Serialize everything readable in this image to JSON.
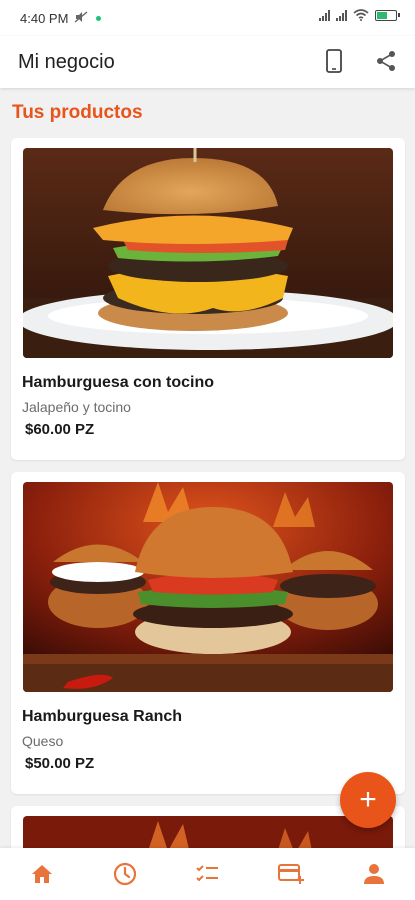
{
  "status_bar": {
    "time": "4:40 PM",
    "battery_level": 0.6
  },
  "app_bar": {
    "title": "Mi negocio",
    "actions": [
      {
        "icon": "phone-icon"
      },
      {
        "icon": "share-icon"
      }
    ]
  },
  "section": {
    "title": "Tus productos"
  },
  "products": [
    {
      "name": "Hamburguesa con tocino",
      "description": "Jalapeño y tocino",
      "price": "$60.00 PZ",
      "image": "bacon-burger-photo"
    },
    {
      "name": "Hamburguesa Ranch",
      "description": "Queso",
      "price": "$50.00 PZ",
      "image": "ranch-burgers-photo"
    },
    {
      "image": "burger-photo-partial"
    }
  ],
  "fab": {
    "label": "+",
    "icon": "add-icon"
  },
  "bottom_nav": [
    {
      "icon": "home-icon"
    },
    {
      "icon": "clock-icon"
    },
    {
      "icon": "checklist-icon"
    },
    {
      "icon": "card-add-icon"
    },
    {
      "icon": "person-icon"
    }
  ],
  "colors": {
    "accent": "#E8541A",
    "background": "#F1F1F1",
    "nav_icon": "#E8743B"
  }
}
